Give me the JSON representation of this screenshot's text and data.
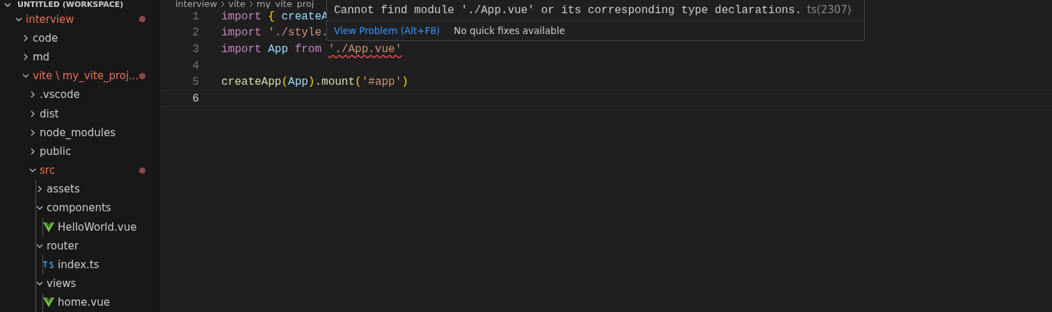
{
  "explorer": {
    "title": "UNTITLED (WORKSPACE)",
    "tree": [
      {
        "label": "interview",
        "kind": "folder",
        "expanded": true,
        "modified": true,
        "children": [
          {
            "label": "code",
            "kind": "folder",
            "expanded": false,
            "modified": false
          },
          {
            "label": "md",
            "kind": "folder",
            "expanded": false,
            "modified": false
          },
          {
            "label": "vite \\ my_vite_proj...",
            "kind": "folder",
            "expanded": true,
            "modified": true,
            "children": [
              {
                "label": ".vscode",
                "kind": "folder",
                "expanded": false,
                "modified": false
              },
              {
                "label": "dist",
                "kind": "folder",
                "expanded": false,
                "modified": false
              },
              {
                "label": "node_modules",
                "kind": "folder",
                "expanded": false,
                "modified": false
              },
              {
                "label": "public",
                "kind": "folder",
                "expanded": false,
                "modified": false
              },
              {
                "label": "src",
                "kind": "folder",
                "expanded": true,
                "modified": true,
                "children": [
                  {
                    "label": "assets",
                    "kind": "folder",
                    "expanded": false,
                    "modified": false
                  },
                  {
                    "label": "components",
                    "kind": "folder",
                    "expanded": true,
                    "modified": false,
                    "children": [
                      {
                        "label": "HelloWorld.vue",
                        "kind": "vue",
                        "modified": false
                      }
                    ]
                  },
                  {
                    "label": "router",
                    "kind": "folder",
                    "expanded": true,
                    "modified": false,
                    "children": [
                      {
                        "label": "index.ts",
                        "kind": "ts",
                        "modified": false
                      }
                    ]
                  },
                  {
                    "label": "views",
                    "kind": "folder",
                    "expanded": true,
                    "modified": false,
                    "children": [
                      {
                        "label": "home.vue",
                        "kind": "vue",
                        "modified": false
                      }
                    ]
                  }
                ]
              }
            ]
          }
        ]
      }
    ]
  },
  "editor": {
    "breadcrumbs": [
      "interview",
      "vite",
      "my_vite_proj"
    ],
    "lines": [
      {
        "number": "1",
        "active": false,
        "tokens": [
          {
            "text": "import ",
            "kind": "keyword"
          },
          {
            "text": "{",
            "kind": "bracket"
          },
          {
            "text": " createA",
            "kind": "variable"
          }
        ]
      },
      {
        "number": "2",
        "active": false,
        "tokens": [
          {
            "text": "import ",
            "kind": "keyword"
          },
          {
            "text": "'./style.",
            "kind": "string"
          }
        ]
      },
      {
        "number": "3",
        "active": false,
        "tokens": [
          {
            "text": "import ",
            "kind": "keyword"
          },
          {
            "text": "App ",
            "kind": "variable"
          },
          {
            "text": "from ",
            "kind": "keyword"
          },
          {
            "text": "'./App.vue'",
            "kind": "string",
            "error": true
          }
        ]
      },
      {
        "number": "4",
        "active": false
      },
      {
        "number": "5",
        "active": false,
        "tokens": [
          {
            "text": "createApp",
            "kind": "function"
          },
          {
            "text": "(",
            "kind": "bracket"
          },
          {
            "text": "App",
            "kind": "variable"
          },
          {
            "text": ")",
            "kind": "bracket"
          },
          {
            "text": ".",
            "kind": "plain"
          },
          {
            "text": "mount",
            "kind": "function"
          },
          {
            "text": "(",
            "kind": "bracket"
          },
          {
            "text": "'#app'",
            "kind": "string"
          },
          {
            "text": ")",
            "kind": "bracket"
          }
        ]
      },
      {
        "number": "6",
        "active": true
      }
    ],
    "hover": {
      "message": "Cannot find module './App.vue' or its corresponding type declarations.",
      "code": "ts(2307)",
      "action": "View Problem (Alt+F8)",
      "note": "No quick fixes available"
    }
  }
}
